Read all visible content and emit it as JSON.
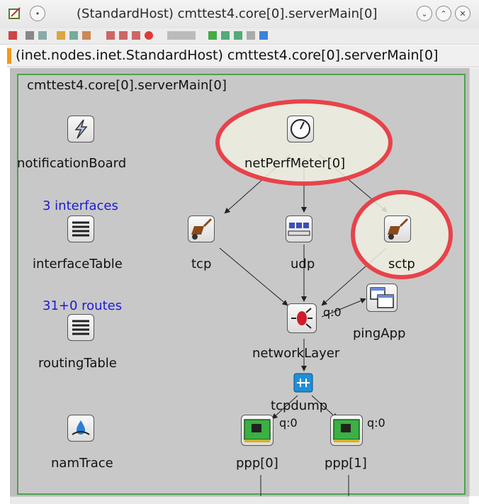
{
  "window": {
    "title": "(StandardHost) cmttest4.core[0].serverMain[0]",
    "path": "(inet.nodes.inet.StandardHost) cmttest4.core[0].serverMain[0]",
    "canvas_title": "cmttest4.core[0].serverMain[0]"
  },
  "colors": {
    "highlight": "#e8424a",
    "border": "#4ca34c",
    "info_text": "#1a1ad8"
  },
  "nodes": {
    "notificationBoard": {
      "label": "notificationBoard",
      "icon": "lightning-icon"
    },
    "interfaceTable": {
      "label": "interfaceTable",
      "info": "3 interfaces",
      "icon": "table-icon"
    },
    "routingTable": {
      "label": "routingTable",
      "info": "31+0 routes",
      "icon": "table-icon"
    },
    "namTrace": {
      "label": "namTrace",
      "icon": "drop-icon"
    },
    "netPerfMeter": {
      "label": "netPerfMeter[0]",
      "icon": "clock-icon"
    },
    "tcp": {
      "label": "tcp",
      "icon": "wheelbarrow-icon"
    },
    "udp": {
      "label": "udp",
      "icon": "queue-icon"
    },
    "sctp": {
      "label": "sctp",
      "icon": "wheelbarrow-icon"
    },
    "networkLayer": {
      "label": "networkLayer",
      "queue": "q:0",
      "icon": "router-icon"
    },
    "pingApp": {
      "label": "pingApp",
      "icon": "windows-icon"
    },
    "tcpdump": {
      "label": "tcpdump",
      "icon": "tap-icon"
    },
    "ppp0": {
      "label": "ppp[0]",
      "queue": "q:0",
      "icon": "nic-icon"
    },
    "ppp1": {
      "label": "ppp[1]",
      "queue": "q:0",
      "icon": "nic-icon"
    }
  }
}
